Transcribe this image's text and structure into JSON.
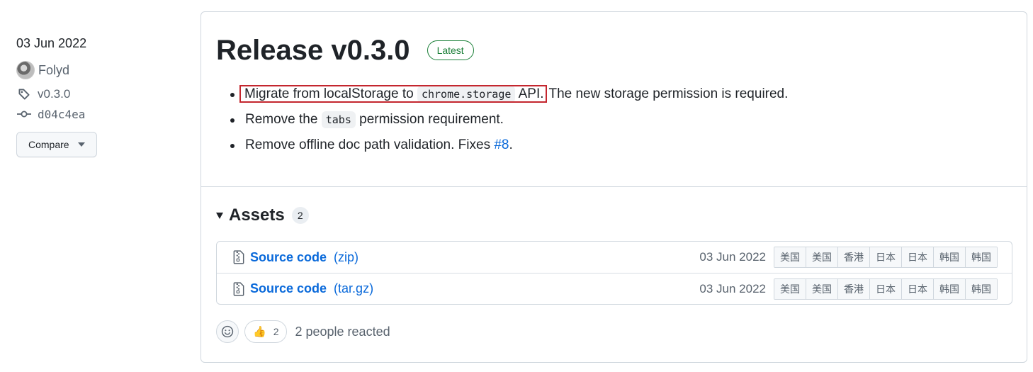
{
  "sidebar": {
    "date": "03 Jun 2022",
    "author": "Folyd",
    "tag": "v0.3.0",
    "commit": "d04c4ea",
    "compare_label": "Compare"
  },
  "release": {
    "title": "Release v0.3.0",
    "badge": "Latest",
    "notes": {
      "item1_highlight_prefix": "Migrate from localStorage to",
      "item1_code": "chrome.storage",
      "item1_highlight_suffix": "API.",
      "item1_rest": "The new storage permission is required.",
      "item2_prefix": "Remove the",
      "item2_code": "tabs",
      "item2_suffix": "permission requirement.",
      "item3_text": "Remove offline doc path validation. Fixes",
      "item3_link": "#8",
      "item3_end": "."
    }
  },
  "assets": {
    "title": "Assets",
    "count": "2",
    "rows": [
      {
        "name": "Source code",
        "ext": "(zip)",
        "date": "03 Jun 2022",
        "mirrors": [
          "美国",
          "美国",
          "香港",
          "日本",
          "日本",
          "韩国",
          "韩国"
        ]
      },
      {
        "name": "Source code",
        "ext": "(tar.gz)",
        "date": "03 Jun 2022",
        "mirrors": [
          "美国",
          "美国",
          "香港",
          "日本",
          "日本",
          "韩国",
          "韩国"
        ]
      }
    ]
  },
  "reactions": {
    "thumbs_count": "2",
    "summary": "2 people reacted"
  },
  "colors": {
    "link": "#0969da",
    "latest_badge": "#1a7f37",
    "highlight_box": "#c4262e"
  },
  "icons": [
    "tag-icon",
    "commit-icon",
    "file-zip-icon",
    "smiley-icon",
    "thumbs-up-icon"
  ]
}
